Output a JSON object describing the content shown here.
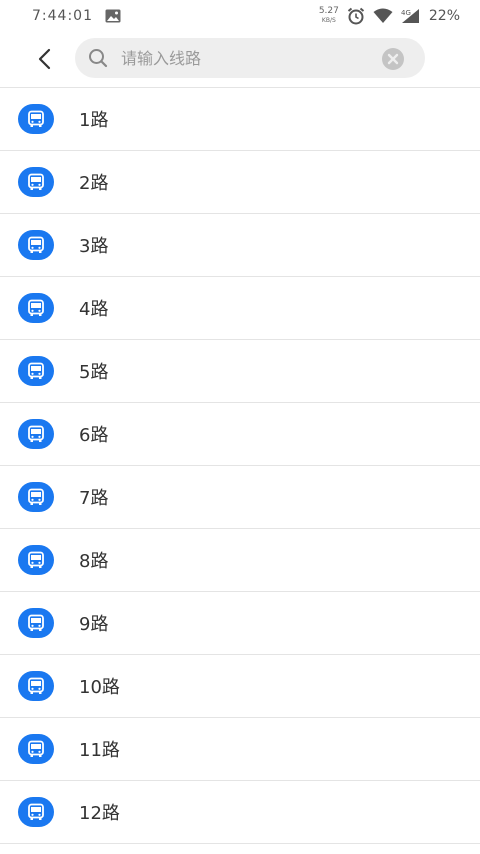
{
  "status_bar": {
    "time": "7:44:01",
    "net_speed_value": "5.27",
    "net_speed_unit": "KB/S",
    "network_type": "4G",
    "battery": "22%"
  },
  "search": {
    "placeholder": "请输入线路",
    "value": ""
  },
  "routes": [
    {
      "label": "1路"
    },
    {
      "label": "2路"
    },
    {
      "label": "3路"
    },
    {
      "label": "4路"
    },
    {
      "label": "5路"
    },
    {
      "label": "6路"
    },
    {
      "label": "7路"
    },
    {
      "label": "8路"
    },
    {
      "label": "9路"
    },
    {
      "label": "10路"
    },
    {
      "label": "11路"
    },
    {
      "label": "12路"
    }
  ],
  "colors": {
    "accent": "#1a78f0",
    "search_bg": "#eeeeee",
    "divider": "#e4e4e4"
  },
  "icons": {
    "back": "back-arrow-icon",
    "search": "search-icon",
    "clear": "clear-icon",
    "route": "bus-icon"
  }
}
